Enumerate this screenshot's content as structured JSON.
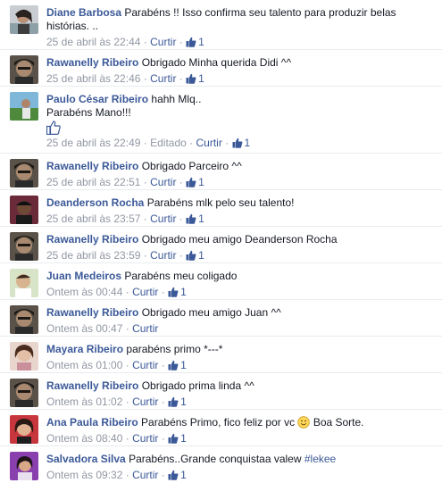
{
  "colors": {
    "link": "#3b5998",
    "meta": "#9197a3",
    "text": "#141823",
    "divider": "#e9ebee"
  },
  "comments": [
    {
      "author": "Diane Barbosa",
      "text": "Parabéns !! Isso confirma seu talento para produzir belas histórias. ..",
      "time": "25 de abril às 22:44",
      "reply_label": "Curtir",
      "likes": "1",
      "avatar": "avatar-diane"
    },
    {
      "author": "Rawanelly Ribeiro",
      "text": "Obrigado Minha querida Didi ^^",
      "time": "25 de abril às 22:46",
      "reply_label": "Curtir",
      "likes": "1",
      "avatar": "avatar-rawanelly"
    },
    {
      "author": "Paulo César Ribeiro",
      "text": "hahh Mlq..",
      "text2": "Parabéns Mano!!!",
      "time": "25 de abril às 22:49",
      "edited_label": "Editado",
      "reply_label": "Curtir",
      "likes": "1",
      "avatar": "avatar-paulo",
      "attachment_icon": "thumbs-up-sticker-icon"
    },
    {
      "author": "Rawanelly Ribeiro",
      "text": "Obrigado Parceiro ^^",
      "time": "25 de abril às 22:51",
      "reply_label": "Curtir",
      "likes": "1",
      "avatar": "avatar-rawanelly"
    },
    {
      "author": "Deanderson Rocha",
      "text": "Parabéns mlk pelo seu talento!",
      "time": "25 de abril às 23:57",
      "reply_label": "Curtir",
      "likes": "1",
      "avatar": "avatar-deanderson"
    },
    {
      "author": "Rawanelly Ribeiro",
      "text": "Obrigado meu amigo Deanderson Rocha",
      "time": "25 de abril às 23:59",
      "reply_label": "Curtir",
      "likes": "1",
      "avatar": "avatar-rawanelly"
    },
    {
      "author": "Juan Medeiros",
      "text": "Parabéns meu coligado",
      "time": "Ontem às 00:44",
      "reply_label": "Curtir",
      "likes": "1",
      "avatar": "avatar-juan"
    },
    {
      "author": "Rawanelly Ribeiro",
      "text": "Obrigado meu amigo Juan ^^",
      "time": "Ontem às 00:47",
      "reply_label": "Curtir",
      "avatar": "avatar-rawanelly"
    },
    {
      "author": "Mayara Ribeiro",
      "text": "parabéns primo *---*",
      "time": "Ontem às 01:00",
      "reply_label": "Curtir",
      "likes": "1",
      "avatar": "avatar-mayara"
    },
    {
      "author": "Rawanelly Ribeiro",
      "text": "Obrigado prima linda ^^",
      "time": "Ontem às 01:02",
      "reply_label": "Curtir",
      "likes": "1",
      "avatar": "avatar-rawanelly"
    },
    {
      "author": "Ana Paula Ribeiro",
      "text": "Parabéns Primo, fico feliz por vc",
      "text_after_emoji": "Boa Sorte.",
      "time": "Ontem às 08:40",
      "reply_label": "Curtir",
      "likes": "1",
      "avatar": "avatar-ana",
      "emoji_icon": "smiley-emoji-icon"
    },
    {
      "author": "Salvadora Silva",
      "text": "Parabéns..Grande conquistaa valew",
      "hashtag": "#lekee",
      "time": "Ontem às 09:32",
      "reply_label": "Curtir",
      "likes": "1",
      "avatar": "avatar-salvadora"
    }
  ]
}
